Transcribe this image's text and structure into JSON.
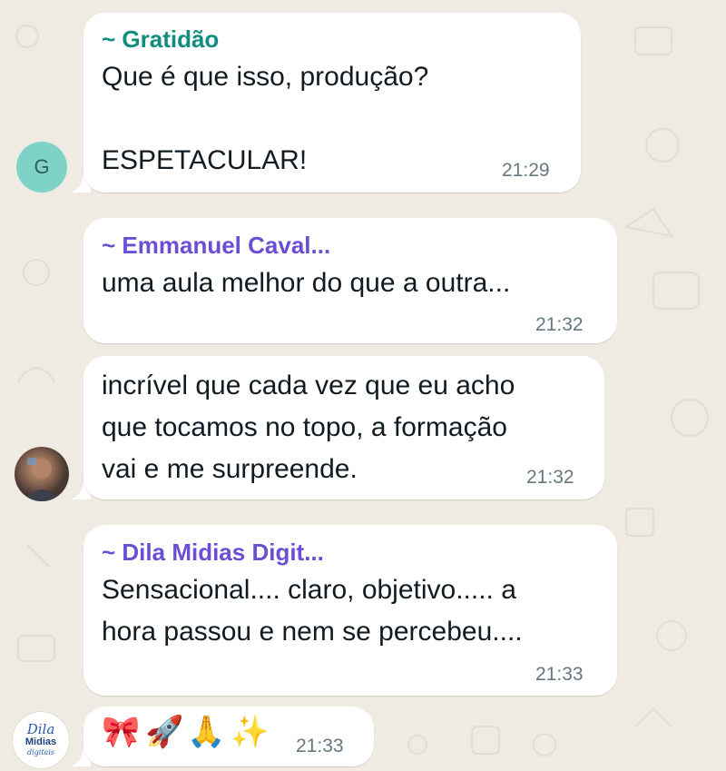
{
  "colors": {
    "chat_background": "#efeae2",
    "bubble": "#ffffff",
    "sender_gratidao": "#128c7e",
    "sender_purple": "#6a4fd6",
    "timestamp": "#667781",
    "avatar_g_bg": "#7fd3c6"
  },
  "messages": [
    {
      "sender": "~ Gratidão",
      "text_line1": "Que é que isso, produção?",
      "text_line2": "",
      "text_line3": "ESPETACULAR!",
      "time": "21:29",
      "avatar_initial": "G"
    },
    {
      "sender": "~ Emmanuel Caval...",
      "text_line1": "uma aula melhor do que a outra...",
      "time": "21:32"
    },
    {
      "text_line1": "incrível que cada vez que eu acho",
      "text_line2": "que tocamos no topo, a formação",
      "text_line3": "vai e me surpreende.",
      "time": "21:32",
      "avatar_icon": "user-photo-icon"
    },
    {
      "sender": "~ Dila Midias Digit...",
      "text_line1": "Sensacional.... claro, objetivo..... a",
      "text_line2": "hora passou e nem se percebeu....",
      "time": "21:33"
    },
    {
      "emojis": [
        "🎀",
        "🚀",
        "🙏",
        "✨"
      ],
      "time": "21:33",
      "avatar_logo": {
        "line1": "Dila",
        "line2": "Midias",
        "line3": "digitais"
      }
    }
  ]
}
